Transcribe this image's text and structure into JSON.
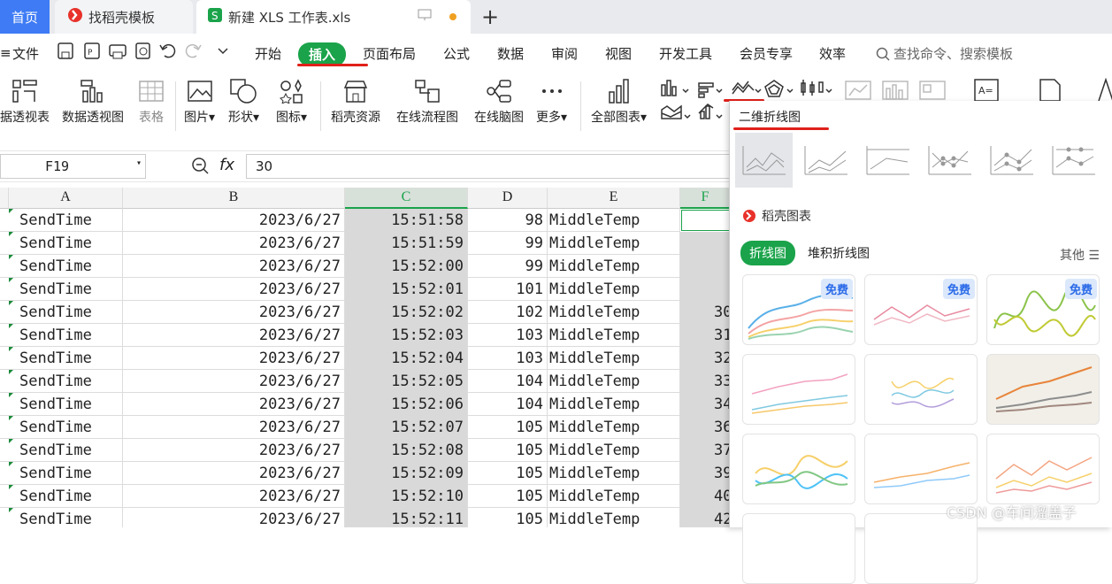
{
  "tabs": {
    "home": "首页",
    "daoke": "找稻壳模板",
    "doc": "新建 XLS 工作表.xls",
    "add": "+"
  },
  "menu": {
    "file": "文件",
    "items": [
      "开始",
      "插入",
      "页面布局",
      "公式",
      "数据",
      "审阅",
      "视图",
      "开发工具",
      "会员专享",
      "效率"
    ],
    "active_index": 1,
    "search": "查找命令、搜索模板"
  },
  "ribbon": {
    "pivot_table": "据透视表",
    "pivot_chart": "数据透视图",
    "table": "表格",
    "picture": "图片",
    "shape": "形状",
    "icon": "图标",
    "daoke_res": "稻壳资源",
    "flowchart": "在线流程图",
    "mindmap": "在线脑图",
    "more": "更多",
    "all_charts": "全部图表"
  },
  "formula_bar": {
    "cell_ref": "F19",
    "fx": "fx",
    "value": "30"
  },
  "columns": [
    "A",
    "B",
    "C",
    "D",
    "E",
    "F"
  ],
  "rows": [
    [
      "SendTime",
      "2023/6/27",
      "15:51:58",
      "98",
      "MiddleTemp",
      ""
    ],
    [
      "SendTime",
      "2023/6/27",
      "15:51:59",
      "99",
      "MiddleTemp",
      ""
    ],
    [
      "SendTime",
      "2023/6/27",
      "15:52:00",
      "99",
      "MiddleTemp",
      ""
    ],
    [
      "SendTime",
      "2023/6/27",
      "15:52:01",
      "101",
      "MiddleTemp",
      ""
    ],
    [
      "SendTime",
      "2023/6/27",
      "15:52:02",
      "102",
      "MiddleTemp",
      "30"
    ],
    [
      "SendTime",
      "2023/6/27",
      "15:52:03",
      "103",
      "MiddleTemp",
      "31"
    ],
    [
      "SendTime",
      "2023/6/27",
      "15:52:04",
      "103",
      "MiddleTemp",
      "32"
    ],
    [
      "SendTime",
      "2023/6/27",
      "15:52:05",
      "104",
      "MiddleTemp",
      "33"
    ],
    [
      "SendTime",
      "2023/6/27",
      "15:52:06",
      "104",
      "MiddleTemp",
      "34"
    ],
    [
      "SendTime",
      "2023/6/27",
      "15:52:07",
      "105",
      "MiddleTemp",
      "36"
    ],
    [
      "SendTime",
      "2023/6/27",
      "15:52:08",
      "105",
      "MiddleTemp",
      "37"
    ],
    [
      "SendTime",
      "2023/6/27",
      "15:52:09",
      "105",
      "MiddleTemp",
      "39"
    ],
    [
      "SendTime",
      "2023/6/27",
      "15:52:10",
      "105",
      "MiddleTemp",
      "40"
    ],
    [
      "SendTime",
      "2023/6/27",
      "15:52:11",
      "105",
      "MiddleTemp",
      "42"
    ]
  ],
  "panel": {
    "title": "二维折线图",
    "daoke_label": "稻壳图表",
    "tab_line": "折线图",
    "tab_stacked": "堆积折线图",
    "other": "其他",
    "free_badge": "免费"
  },
  "watermark": "CSDN @车间溜盖子",
  "colors": {
    "accent": "#1aa34a",
    "home_tab": "#3e7bf5",
    "annotation": "#e0201a"
  }
}
